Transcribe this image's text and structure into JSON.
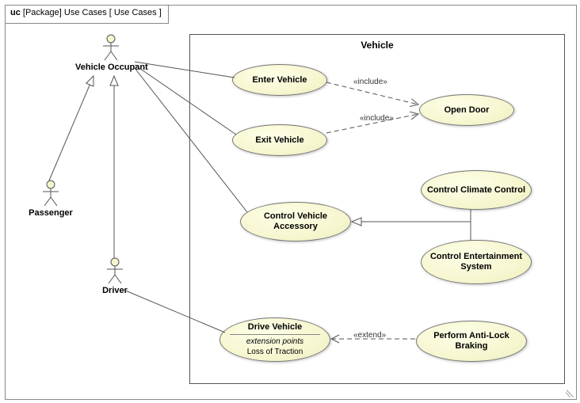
{
  "frame": {
    "kind": "uc",
    "kind_detail": "[Package]",
    "name": "Use Cases",
    "context": "[ Use Cases ]"
  },
  "subject": {
    "name": "Vehicle"
  },
  "actors": {
    "vehicle_occupant": "Vehicle Occupant",
    "passenger": "Passenger",
    "driver": "Driver"
  },
  "usecases": {
    "enter_vehicle": "Enter Vehicle",
    "exit_vehicle": "Exit Vehicle",
    "open_door": "Open Door",
    "control_vehicle_accessory": "Control Vehicle Accessory",
    "control_climate_control": "Control Climate Control",
    "control_entertainment_system": "Control Entertainment System",
    "drive_vehicle": {
      "name": "Drive Vehicle",
      "ep_title": "extension points",
      "ep": "Loss of Traction"
    },
    "perform_anti_lock_braking": "Perform Anti-Lock Braking"
  },
  "edge_labels": {
    "include1": "«include»",
    "include2": "«include»",
    "extend1": "«extend»"
  },
  "chart_data": {
    "type": "diagram",
    "notation": "UML / SysML Use Case Diagram",
    "frame": "uc [Package] Use Cases [ Use Cases ]",
    "subject": "Vehicle",
    "actors": [
      "Vehicle Occupant",
      "Passenger",
      "Driver"
    ],
    "use_cases": [
      "Enter Vehicle",
      "Exit Vehicle",
      "Open Door",
      "Control Vehicle Accessory",
      "Control Climate Control",
      "Control Entertainment System",
      {
        "name": "Drive Vehicle",
        "extension_points": [
          "Loss of Traction"
        ]
      },
      "Perform Anti-Lock Braking"
    ],
    "relationships": [
      {
        "type": "generalization",
        "from": "Passenger",
        "to": "Vehicle Occupant"
      },
      {
        "type": "generalization",
        "from": "Driver",
        "to": "Vehicle Occupant"
      },
      {
        "type": "association",
        "from": "Vehicle Occupant",
        "to": "Enter Vehicle"
      },
      {
        "type": "association",
        "from": "Vehicle Occupant",
        "to": "Exit Vehicle"
      },
      {
        "type": "association",
        "from": "Vehicle Occupant",
        "to": "Control Vehicle Accessory"
      },
      {
        "type": "association",
        "from": "Driver",
        "to": "Drive Vehicle"
      },
      {
        "type": "include",
        "from": "Enter Vehicle",
        "to": "Open Door"
      },
      {
        "type": "include",
        "from": "Exit Vehicle",
        "to": "Open Door"
      },
      {
        "type": "generalization",
        "from": "Control Climate Control",
        "to": "Control Vehicle Accessory"
      },
      {
        "type": "generalization",
        "from": "Control Entertainment System",
        "to": "Control Vehicle Accessory"
      },
      {
        "type": "extend",
        "from": "Perform Anti-Lock Braking",
        "to": "Drive Vehicle"
      }
    ]
  }
}
